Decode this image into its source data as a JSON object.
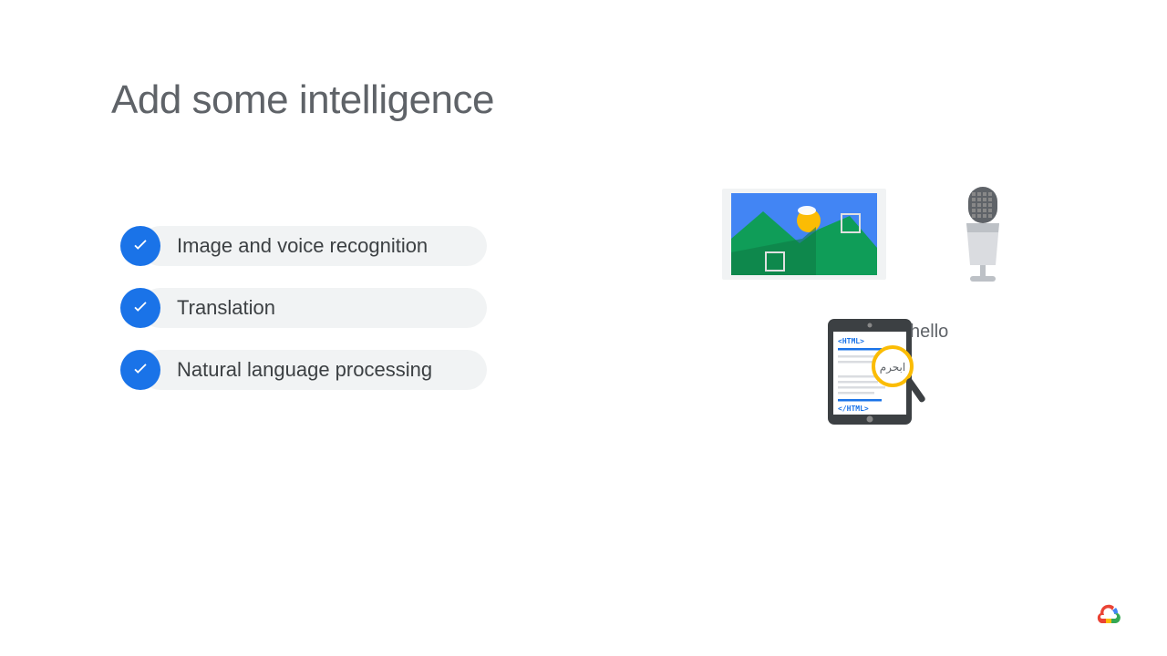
{
  "title": "Add some intelligence",
  "bullets": [
    {
      "label": "Image and voice recognition"
    },
    {
      "label": "Translation"
    },
    {
      "label": "Natural language processing"
    }
  ],
  "illustrations": {
    "landscape_icon": "landscape-photo-icon",
    "microphone_icon": "microphone-icon",
    "tablet_icon": "tablet-html-magnifier-icon",
    "tablet_tag_open": "<HTML>",
    "tablet_tag_close": "</HTML>",
    "tablet_arabic": "ابحرم",
    "hello_label": "hello"
  },
  "footer": {
    "logo": "google-cloud-logo"
  }
}
